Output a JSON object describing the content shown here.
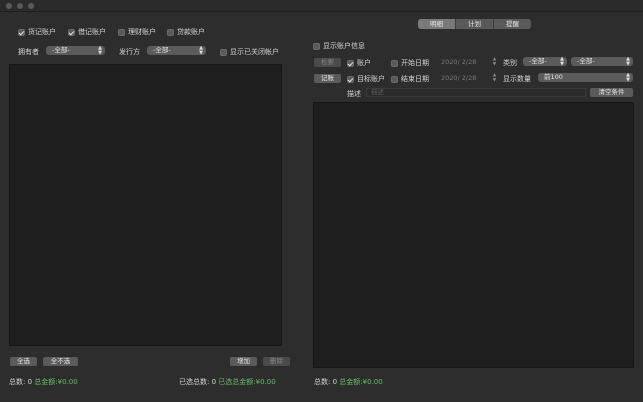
{
  "left": {
    "account_types": [
      {
        "label": "货记账户",
        "checked": true
      },
      {
        "label": "借记账户",
        "checked": true
      },
      {
        "label": "理财账户",
        "checked": false
      },
      {
        "label": "贷款账户",
        "checked": false
      }
    ],
    "owner_label": "拥有者",
    "owner_value": "-全部-",
    "issuer_label": "发行方",
    "issuer_value": "-全部-",
    "show_closed_label": "显示已关闭帐户",
    "select_all": "全选",
    "select_none": "全不选",
    "add": "增加",
    "delete": "删除",
    "total_count_label": "总数:",
    "total_count": "0",
    "total_amount_label": "总金额:",
    "total_amount": "¥0.00",
    "selected_count_label": "已选总数:",
    "selected_count": "0",
    "selected_amount_label": "已选总金额:",
    "selected_amount": "¥0.00"
  },
  "right": {
    "tabs": [
      "明细",
      "计划",
      "提醒"
    ],
    "active_tab": 0,
    "show_account_info": "显示账户信息",
    "retrieve": "检索",
    "bookkeep": "记账",
    "account_label": "账户",
    "target_account_label": "目标账户",
    "start_date_label": "开始日期",
    "end_date_label": "结束日期",
    "start_date": "2020/ 2/28",
    "end_date": "2020/ 2/28",
    "category_label": "类别",
    "category_value": "-全部-",
    "category_sub_value": "-全部-",
    "count_label": "显示数量",
    "count_value": "前100",
    "desc_label": "描述",
    "desc_placeholder": "描述",
    "clear": "清空条件",
    "total_count_label": "总数:",
    "total_count": "0",
    "total_amount_label": "总金额:",
    "total_amount": "¥0.00"
  },
  "colors": {
    "accent_green": "#5dc35d"
  },
  "icons": {
    "select_arrows": "updown-arrows-icon",
    "checkmark": "check-icon"
  }
}
